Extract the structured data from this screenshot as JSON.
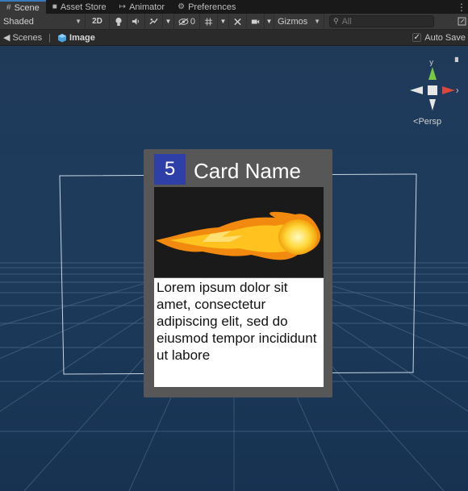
{
  "tabs": [
    {
      "label": "Scene",
      "icon": "grid-icon",
      "active": true
    },
    {
      "label": "Asset Store",
      "icon": "store-bag-icon",
      "active": false
    },
    {
      "label": "Animator",
      "icon": "animator-icon",
      "active": false
    },
    {
      "label": "Preferences",
      "icon": "gear-icon",
      "active": false
    }
  ],
  "toolbar": {
    "draw_mode": "Shaded",
    "mode_2d": "2D",
    "hidden_count": "0",
    "gizmos": "Gizmos",
    "search_placeholder": "All"
  },
  "breadcrumb": {
    "root": "Scenes",
    "current": "Image"
  },
  "autosave": {
    "label": "Auto Save",
    "checked": true
  },
  "scene_gizmo": {
    "axis_y": "y",
    "axis_x": "x",
    "projection": "Persp"
  },
  "card": {
    "cost": "5",
    "name": "Card Name",
    "art": "fireball-icon",
    "description": "Lorem ipsum dolor sit amet, consectetur adipiscing elit, sed do eiusmod tempor incididunt ut labore"
  },
  "colors": {
    "viewport_bg": "#1e3b5c",
    "card_frame": "#575757",
    "cost_badge": "#2f3fa8",
    "gizmo_y": "#7ac943",
    "gizmo_x": "#d9483b",
    "active_tab_accent": "#3a79bb"
  }
}
